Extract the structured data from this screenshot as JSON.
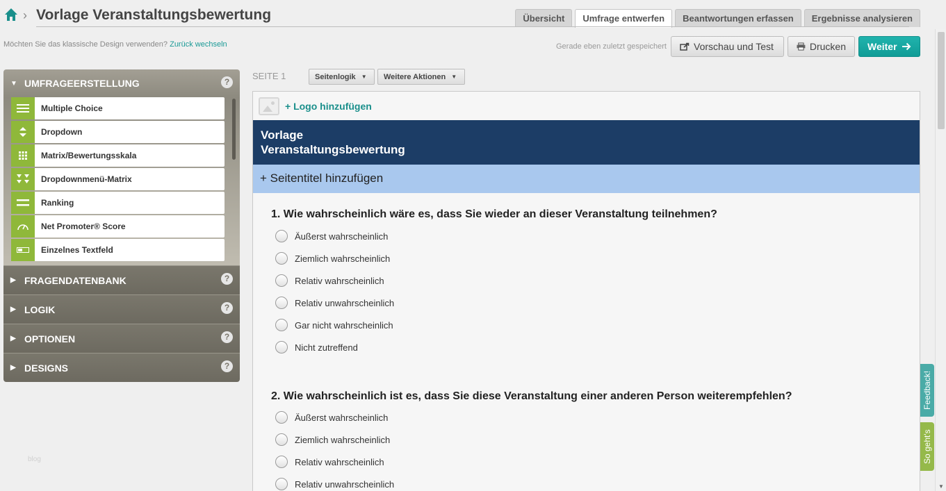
{
  "header": {
    "title": "Vorlage Veranstaltungsbewertung",
    "tabs": [
      {
        "label": "Übersicht",
        "active": false
      },
      {
        "label": "Umfrage entwerfen",
        "active": true
      },
      {
        "label": "Beantwortungen erfassen",
        "active": false
      },
      {
        "label": "Ergebnisse analysieren",
        "active": false
      }
    ]
  },
  "toolbar": {
    "classic_text": "Möchten Sie das klassische Design verwenden?",
    "classic_link": "Zurück wechseln",
    "saved_text": "Gerade eben zuletzt gespeichert",
    "preview_label": "Vorschau und Test",
    "print_label": "Drucken",
    "next_label": "Weiter"
  },
  "sidebar": {
    "sections": [
      {
        "label": "UMFRAGEERSTELLUNG",
        "open": true
      },
      {
        "label": "FRAGENDATENBANK",
        "open": false
      },
      {
        "label": "LOGIK",
        "open": false
      },
      {
        "label": "OPTIONEN",
        "open": false
      },
      {
        "label": "DESIGNS",
        "open": false
      }
    ],
    "help": "?",
    "question_types": [
      {
        "label": "Multiple Choice",
        "icon": "list-icon"
      },
      {
        "label": "Dropdown",
        "icon": "updown-icon"
      },
      {
        "label": "Matrix/Bewertungsskala",
        "icon": "grid-icon"
      },
      {
        "label": "Dropdownmenü-Matrix",
        "icon": "double-caret-icon"
      },
      {
        "label": "Ranking",
        "icon": "ranking-icon"
      },
      {
        "label": "Net Promoter® Score",
        "icon": "gauge-icon"
      },
      {
        "label": "Einzelnes Textfeld",
        "icon": "textfield-icon"
      }
    ],
    "footer_text": "blog"
  },
  "main": {
    "page_label": "SEITE 1",
    "page_logic": "Seitenlogik",
    "more_actions": "Weitere Aktionen",
    "add_logo": "+ Logo hinzufügen",
    "survey_title_line1": "Vorlage",
    "survey_title_line2": "Veranstaltungsbewertung",
    "add_page_title": "+ Seitentitel hinzufügen",
    "questions": [
      {
        "title": "1. Wie wahrscheinlich wäre es, dass Sie wieder an dieser Veranstaltung teilnehmen?",
        "options": [
          "Äußerst wahrscheinlich",
          "Ziemlich wahrscheinlich",
          "Relativ wahrscheinlich",
          "Relativ unwahrscheinlich",
          "Gar nicht wahrscheinlich",
          "Nicht zutreffend"
        ]
      },
      {
        "title": "2. Wie wahrscheinlich ist es, dass Sie diese Veranstaltung einer anderen Person weiterempfehlen?",
        "options": [
          "Äußerst wahrscheinlich",
          "Ziemlich wahrscheinlich",
          "Relativ wahrscheinlich",
          "Relativ unwahrscheinlich"
        ]
      }
    ]
  },
  "side_tabs": {
    "feedback": "Feedback!",
    "sogehts": "So geht's"
  },
  "colors": {
    "accent": "#1aa59f",
    "banner": "#1c3d66",
    "page_title_bar": "#a9c8ee",
    "question_icon": "#8fb83a"
  }
}
